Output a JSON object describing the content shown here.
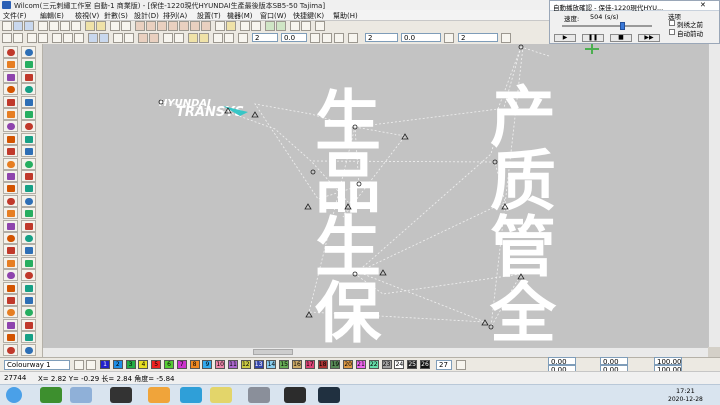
{
  "window": {
    "title": "Wilcom(三元刺繡工作室   自動-1 商業版) - [保佳-1220現代HYUNDAI生產最後版本SB5-50      Tajima]"
  },
  "menu": [
    "文件(F)",
    "編輯(E)",
    "檢視(V)",
    "針數(S)",
    "設計(D)",
    "排列(A)",
    "設置(T)",
    "機器(M)",
    "窗口(W)",
    "快捷鍵(K)",
    "幫助(H)"
  ],
  "toolbar": {
    "value_a": "2",
    "value_b": "0.0",
    "value_c": "2",
    "value_d": "0.0",
    "value_e": "2"
  },
  "design": {
    "logo_line1": "HYUNDAI",
    "logo_line2": "TRANSYS",
    "col_left": [
      "生",
      "品",
      "生",
      "保"
    ],
    "col_right": [
      "产",
      "质",
      "管",
      "全"
    ]
  },
  "panel": {
    "title": "自動播放確認 - 保佳-1220現代HYU...",
    "speed_label": "速度:",
    "speed_value": "504 (s/s)",
    "options_label": "选项",
    "opt1": "刺绣之前",
    "opt2": "自动前动"
  },
  "colorbar": {
    "colorway": "Colourway 1",
    "swatches": [
      {
        "n": "1",
        "c": "#2222cc"
      },
      {
        "n": "2",
        "c": "#1e8ee6"
      },
      {
        "n": "3",
        "c": "#22aa44"
      },
      {
        "n": "4",
        "c": "#e6dd22"
      },
      {
        "n": "5",
        "c": "#ee2222"
      },
      {
        "n": "6",
        "c": "#55cc33"
      },
      {
        "n": "7",
        "c": "#cc33cc"
      },
      {
        "n": "8",
        "c": "#ee8822"
      },
      {
        "n": "9",
        "c": "#33aaee"
      },
      {
        "n": "10",
        "c": "#ee88aa"
      },
      {
        "n": "11",
        "c": "#aa66cc"
      },
      {
        "n": "12",
        "c": "#cccc44"
      },
      {
        "n": "13",
        "c": "#3344aa"
      },
      {
        "n": "14",
        "c": "#88ccee"
      },
      {
        "n": "15",
        "c": "#66aa55"
      },
      {
        "n": "16",
        "c": "#ccaa66"
      },
      {
        "n": "17",
        "c": "#dd4477"
      },
      {
        "n": "18",
        "c": "#aa3333"
      },
      {
        "n": "19",
        "c": "#558855"
      },
      {
        "n": "20",
        "c": "#dd9944"
      },
      {
        "n": "21",
        "c": "#ee66ee"
      },
      {
        "n": "22",
        "c": "#66ddaa"
      },
      {
        "n": "23",
        "c": "#a0a0a0"
      },
      {
        "n": "24",
        "c": "#ffffff"
      },
      {
        "n": "25",
        "c": "#222222"
      },
      {
        "n": "26",
        "c": "#111111"
      }
    ],
    "current": "27",
    "fields": [
      "0.00",
      "0.00",
      "100.00",
      "0.00",
      "0.00",
      "100.00"
    ]
  },
  "status": {
    "stitches": "27744",
    "x": "X=   2.82 Y=  -0.29 长=    2.84 角度=  -5.84"
  },
  "taskbar": {
    "time": "17:21",
    "date": "2020-12-28"
  },
  "colors": {
    "canvas": "#c3c3c3",
    "thread_white": "#ffffff",
    "logo_accent": "#37c6c6"
  }
}
